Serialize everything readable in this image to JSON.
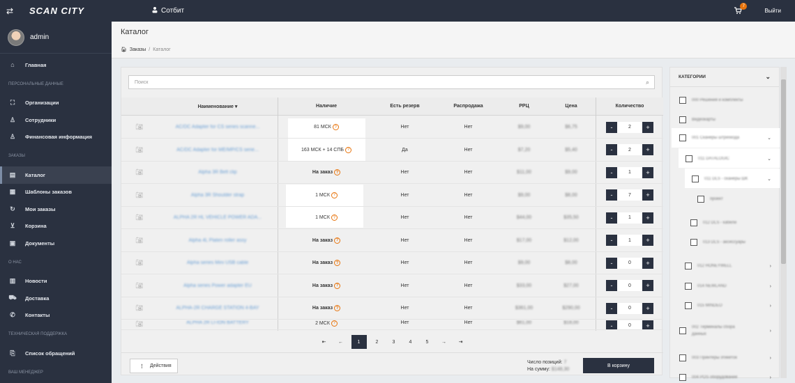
{
  "topbar": {
    "logo": "SCAN CITY",
    "company": "Сотбит",
    "cart_count": "7",
    "logout": "Выйти"
  },
  "user": {
    "name": "admin"
  },
  "nav": {
    "home": "Главная",
    "sec_personal": "ПЕРСОНАЛЬНЫЕ ДАННЫЕ",
    "orgs": "Организации",
    "staff": "Сотрудники",
    "finance": "Финансовая информация",
    "sec_orders": "ЗАКАЗЫ",
    "catalog": "Каталог",
    "templates": "Шаблоны заказов",
    "my_orders": "Мои заказы",
    "cart": "Корзина",
    "docs": "Документы",
    "sec_about": "О НАС",
    "news": "Новости",
    "delivery": "Доставка",
    "contacts": "Контакты",
    "sec_support": "ТЕХНИЧЕСКАЯ ПОДДЕРЖКА",
    "tickets": "Список обращений",
    "sec_manager": "ВАШ МЕНЕДЖЕР"
  },
  "page": {
    "title": "Каталог",
    "crumb_orders": "Заказы",
    "crumb_sep": "/",
    "crumb_catalog": "Каталог"
  },
  "search": {
    "placeholder": "Поиск"
  },
  "table": {
    "headers": {
      "name": "Наименование ▾",
      "avail": "Наличие",
      "reserve": "Есть резерв",
      "sale": "Распродажа",
      "rrc": "РРЦ",
      "price": "Цена",
      "qty": "Количество"
    },
    "rows": [
      {
        "name": "AC/DC Adapter for CS series scanne...",
        "avail": "81 МСК",
        "reserve": "Нет",
        "sale": "Нет",
        "rrc": "$9,00",
        "price": "$6,75",
        "qty": "2"
      },
      {
        "name": "AC/DC Adapter for ME/MP/CS serie...",
        "avail": "163 МСК + 14 СПБ",
        "reserve": "Да",
        "sale": "Нет",
        "rrc": "$7,20",
        "price": "$5,40",
        "qty": "2"
      },
      {
        "name": "Alpha 3R Belt clip",
        "avail": "На заказ",
        "reserve": "Нет",
        "sale": "Нет",
        "rrc": "$11,00",
        "price": "$9,00",
        "qty": "1"
      },
      {
        "name": "Alpha 3R Shoulder strap",
        "avail": "1 МСК",
        "reserve": "Нет",
        "sale": "Нет",
        "rrc": "$9,00",
        "price": "$8,00",
        "qty": "7"
      },
      {
        "name": "ALPHA 2R HL VEHICLE POWER ADA...",
        "avail": "1 МСК",
        "reserve": "Нет",
        "sale": "Нет",
        "rrc": "$44,00",
        "price": "$35,50",
        "qty": "1"
      },
      {
        "name": "Alpha 4L Platen roller assy",
        "avail": "На заказ",
        "reserve": "Нет",
        "sale": "Нет",
        "rrc": "$17,00",
        "price": "$12,00",
        "qty": "1"
      },
      {
        "name": "Alpha series Mini USB cable",
        "avail": "На заказ",
        "reserve": "Нет",
        "sale": "Нет",
        "rrc": "$9,00",
        "price": "$8,00",
        "qty": "0"
      },
      {
        "name": "Alpha series Power adapter EU",
        "avail": "На заказ",
        "reserve": "Нет",
        "sale": "Нет",
        "rrc": "$33,00",
        "price": "$27,00",
        "qty": "0"
      },
      {
        "name": "ALPHA-2R CHARGE STATION 4-BAY",
        "avail": "На заказ",
        "reserve": "Нет",
        "sale": "Нет",
        "rrc": "$361,00",
        "price": "$290,00",
        "qty": "0"
      },
      {
        "name": "ALPHA 2R LI-ION BATTERY",
        "avail": "2 МСК",
        "reserve": "Нет",
        "sale": "Нет",
        "rrc": "$61,00",
        "price": "$18,00",
        "qty": "0"
      }
    ]
  },
  "pager": {
    "first": "⇤",
    "prev": "←",
    "p1": "1",
    "p2": "2",
    "p3": "3",
    "p4": "4",
    "p5": "5",
    "next": "→",
    "last": "⇥"
  },
  "footer": {
    "actions": "Действия",
    "count_label": "Число позиций:",
    "count_val": "7",
    "sum_label": "На сумму:",
    "sum_val": "$148,30",
    "to_cart": "В корзину"
  },
  "categories": {
    "title": "КАТЕГОРИИ",
    "items": [
      "000 Решения и комплекты",
      "Видеокарты",
      "001 Сканеры штрихкода",
      "011 DATALOGIC",
      "011 DLS - сканеры ШК",
      "проект",
      "012 DLS - кабели",
      "013 DLS - аксессуары",
      "012 HONEYWELL",
      "014 NEWLAND",
      "015 MINDEO",
      "002 Терминалы сбора данных",
      "003 Принтеры этикеток",
      "004 POS оборудование"
    ]
  }
}
